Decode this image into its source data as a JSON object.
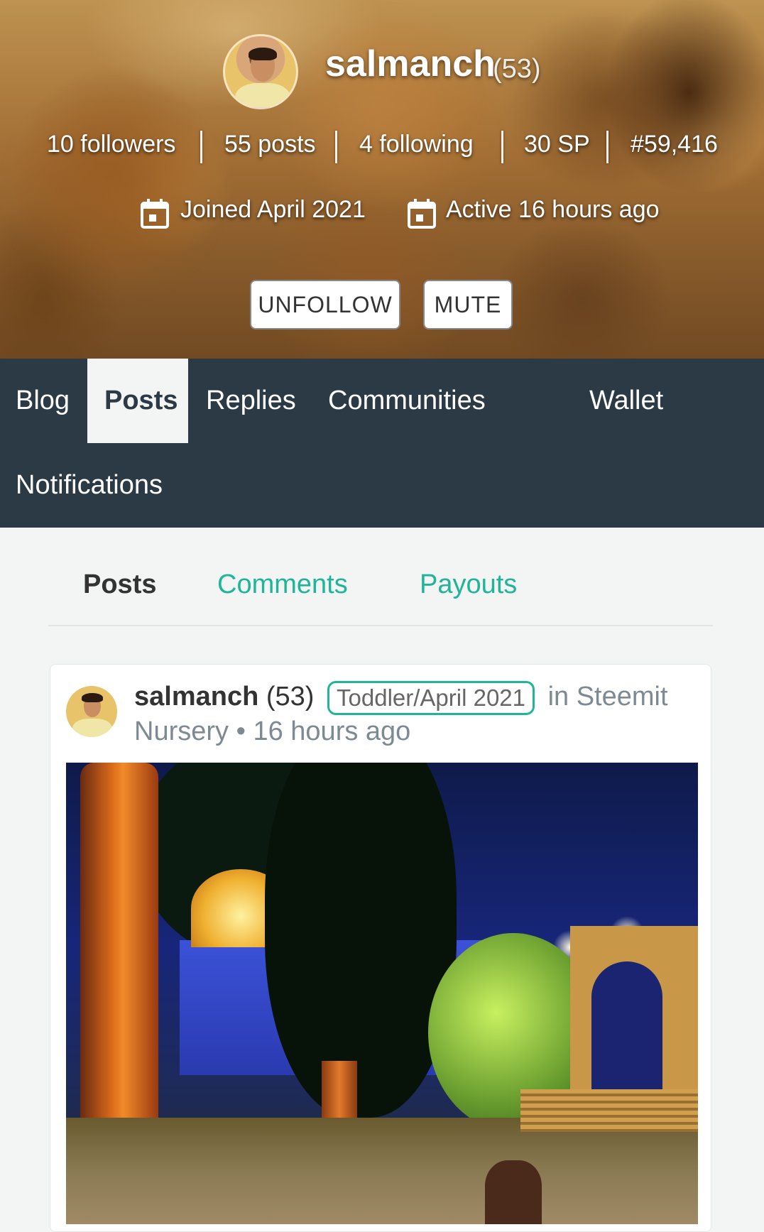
{
  "profile": {
    "username": "salmanch",
    "reputation": "(53)",
    "stats": {
      "followers": "10 followers",
      "posts": "55 posts",
      "following": "4 following",
      "sp": "30 SP",
      "rank": "#59,416"
    },
    "joined": "Joined April 2021",
    "active": "Active 16 hours ago",
    "buttons": {
      "unfollow": "UNFOLLOW",
      "mute": "MUTE"
    }
  },
  "nav": {
    "items": [
      "Blog",
      "Posts",
      "Replies",
      "Communities",
      "Wallet",
      "Notifications"
    ],
    "active": "Posts"
  },
  "subtabs": {
    "items": [
      "Posts",
      "Comments",
      "Payouts"
    ],
    "active": "Posts"
  },
  "post": {
    "author": "salmanch",
    "reputation": "(53)",
    "badge": "Toddler/April 2021",
    "community_prefix": "in Steemit",
    "community_rest": "Nursery",
    "separator": "•",
    "time": "16 hours ago"
  },
  "colors": {
    "nav_bg": "#2b3a45",
    "accent": "#1fb596",
    "page_bg": "#f3f4f4"
  },
  "icons": [
    "calendar-icon",
    "calendar-icon"
  ]
}
